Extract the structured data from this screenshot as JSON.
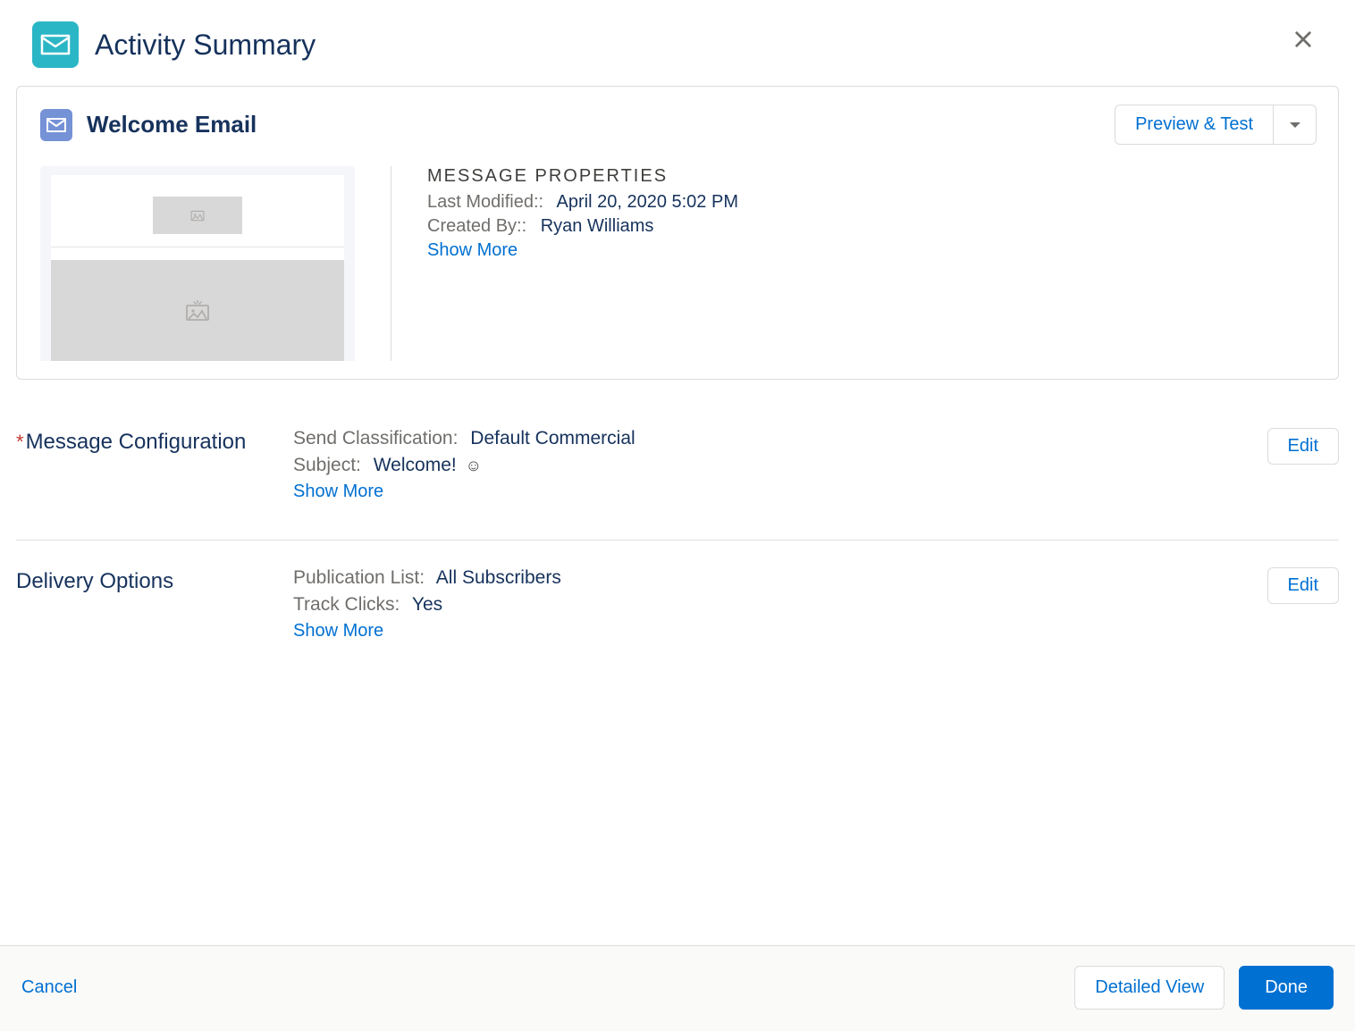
{
  "header": {
    "title": "Activity Summary"
  },
  "email_card": {
    "title": "Welcome Email",
    "preview_button": "Preview & Test",
    "properties_heading": "MESSAGE PROPERTIES",
    "last_modified_label": "Last Modified::",
    "last_modified_value": "April 20, 2020 5:02 PM",
    "created_by_label": "Created By::",
    "created_by_value": "Ryan Williams",
    "show_more": "Show More"
  },
  "sections": {
    "message_config": {
      "title": "Message Configuration",
      "edit": "Edit",
      "send_classification_label": "Send Classification:",
      "send_classification_value": "Default Commercial",
      "subject_label": "Subject:",
      "subject_value": "Welcome!",
      "subject_emoji": "☺",
      "show_more": "Show More"
    },
    "delivery_options": {
      "title": "Delivery Options",
      "edit": "Edit",
      "publication_list_label": "Publication List:",
      "publication_list_value": "All Subscribers",
      "track_clicks_label": "Track Clicks:",
      "track_clicks_value": "Yes",
      "show_more": "Show More"
    }
  },
  "footer": {
    "cancel": "Cancel",
    "detailed_view": "Detailed View",
    "done": "Done"
  }
}
